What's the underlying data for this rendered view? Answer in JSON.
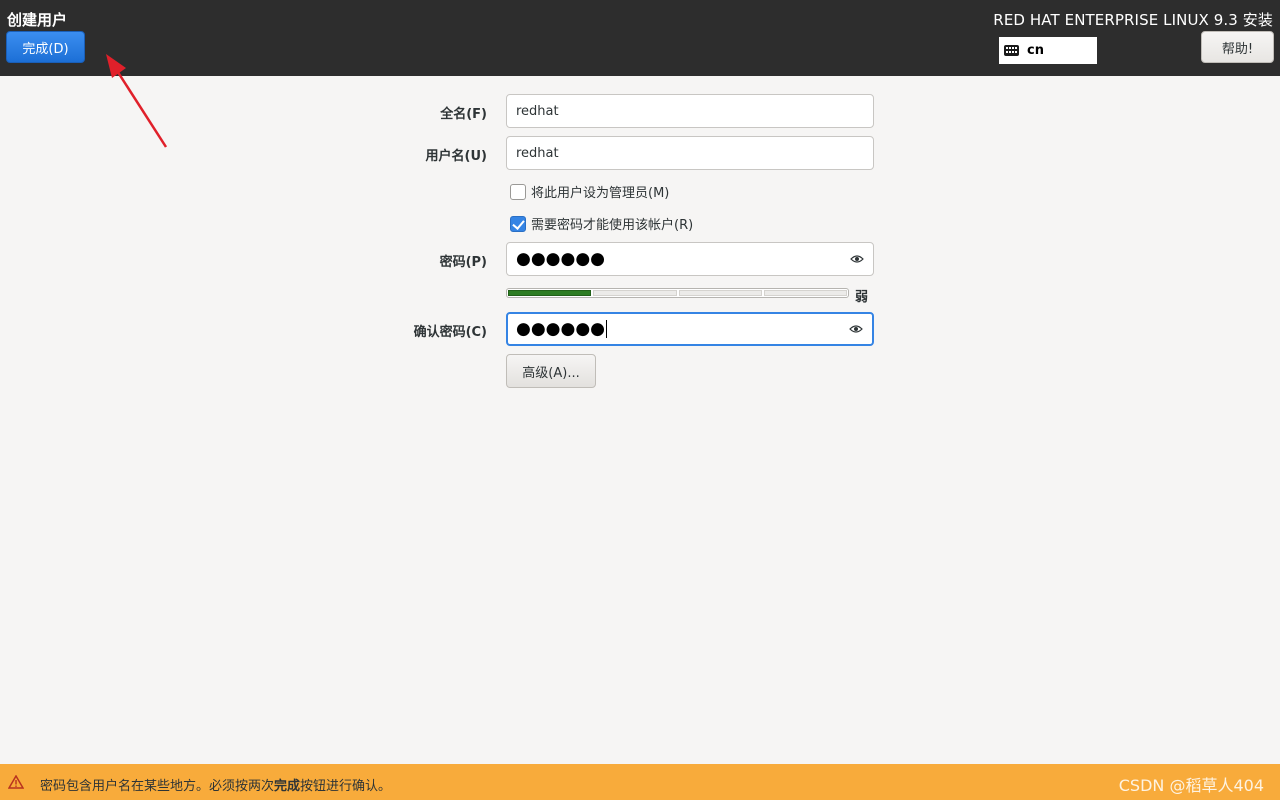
{
  "header": {
    "spoke_title": "创建用户",
    "done_label": "完成(D)",
    "product_title": "RED HAT ENTERPRISE LINUX 9.3 安装",
    "keyboard_layout": "cn",
    "help_label": "帮助!"
  },
  "form": {
    "fullname_label": "全名(F)",
    "fullname_value": "redhat",
    "username_label": "用户名(U)",
    "username_value": "redhat",
    "admin_label": "将此用户设为管理员(M)",
    "admin_checked": false,
    "require_password_label": "需要密码才能使用该帐户(R)",
    "require_password_checked": true,
    "password_label": "密码(P)",
    "password_value": "●●●●●●",
    "strength_level": 0.25,
    "strength_text": "弱",
    "confirm_label": "确认密码(C)",
    "confirm_value": "●●●●●●",
    "advanced_label": "高级(A)..."
  },
  "warning": {
    "text_before": "密码包含用户名在某些地方。必须按两次",
    "text_bold": "完成",
    "text_after": "按钮进行确认。"
  },
  "watermark": "CSDN @稻草人404",
  "colors": {
    "header_bg": "#2d2d2d",
    "accent": "#3584e4",
    "warning_bg": "#f8ab3b",
    "strength_fill": "#2d7d23",
    "annotation_arrow": "#e0202a"
  },
  "icons": {
    "keyboard": "keyboard-icon",
    "reveal": "eye-icon",
    "warning": "warning-triangle-icon",
    "annotation": "red-arrow-icon"
  }
}
